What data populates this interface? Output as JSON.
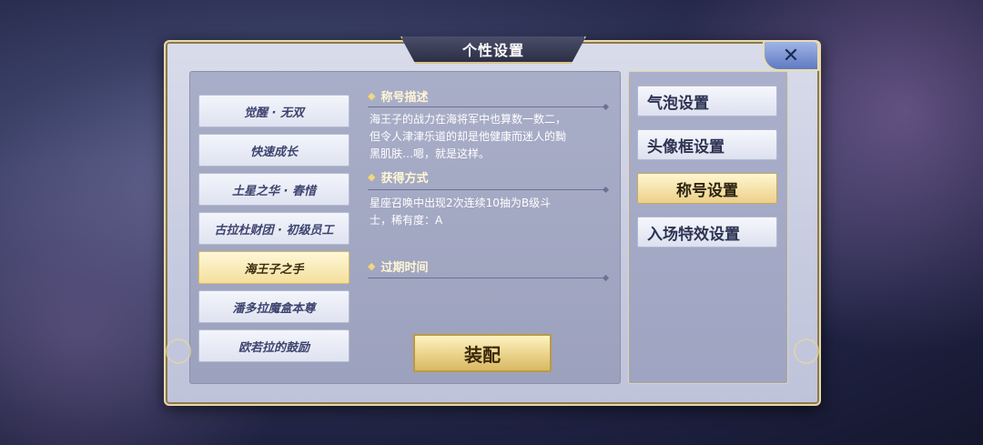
{
  "dialog": {
    "title": "个性设置",
    "close_label": "✕"
  },
  "title_list": [
    {
      "label": "觉醒 · 无双",
      "active": false
    },
    {
      "label": "快速成长",
      "active": false
    },
    {
      "label": "土星之华 · 春惜",
      "active": false
    },
    {
      "label": "古拉杜财团 · 初级员工",
      "active": false
    },
    {
      "label": "海王子之手",
      "active": true
    },
    {
      "label": "潘多拉魔盒本尊",
      "active": false
    },
    {
      "label": "欧若拉的鼓励",
      "active": false
    }
  ],
  "details": {
    "description_header": "称号描述",
    "description_text": "海王子的战力在海将军中也算数一数二，但令人津津乐道的却是他健康而迷人的黝黑肌肤…嗯，就是这样。",
    "obtain_header": "获得方式",
    "obtain_text": "星座召唤中出现2次连续10抽为B级斗士，稀有度：A",
    "expire_header": "过期时间",
    "expire_text": ""
  },
  "equip_button": "装配",
  "tabs": [
    {
      "label": "气泡设置",
      "active": false
    },
    {
      "label": "头像框设置",
      "active": false
    },
    {
      "label": "称号设置",
      "active": true
    },
    {
      "label": "入场特效设置",
      "active": false
    }
  ],
  "colors": {
    "accent_gold": "#ecd08a",
    "panel_bg": "#c7cbe0",
    "header_text": "#fff6d6"
  }
}
